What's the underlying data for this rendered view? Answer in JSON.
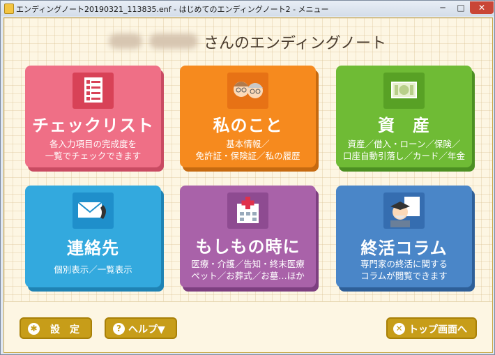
{
  "window": {
    "title": "エンディングノート20190321_113835.enf - はじめてのエンディングノート2 - メニュー",
    "min_glyph": "─",
    "max_glyph": "□",
    "close_glyph": "✕"
  },
  "heading": {
    "suffix": "さんのエンディングノート"
  },
  "tiles": [
    {
      "title": "チェックリスト",
      "line1": "各入力項目の完成度を",
      "line2": "一覧でチェックできます",
      "icon": "checklist-icon",
      "color": "#ef6f86"
    },
    {
      "title": "私のこと",
      "line1": "基本情報／",
      "line2": "免許証・保険証／私の履歴",
      "icon": "elderly-couple-icon",
      "color": "#f68a1e"
    },
    {
      "title": "資　産",
      "line1": "資産／借入・ローン／保険／",
      "line2": "口座自動引落し／カード／年金",
      "icon": "money-icon",
      "color": "#6fbb35"
    },
    {
      "title": "連絡先",
      "line1": "個別表示／一覧表示",
      "line2": "",
      "icon": "envelope-phone-icon",
      "color": "#33a9de"
    },
    {
      "title": "もしもの時に",
      "line1": "医療・介護／告知・終末医療",
      "line2": "ペット／お葬式／お墓…ほか",
      "icon": "hospital-icon",
      "color": "#a962a9"
    },
    {
      "title": "終活コラム",
      "line1": "専門家の終活に関する",
      "line2": "コラムが閲覧できます",
      "icon": "professor-icon",
      "color": "#4a86c8"
    }
  ],
  "buttons": {
    "settings": "設　定",
    "help": "ヘルプ▼",
    "top": "トップ画面へ"
  }
}
